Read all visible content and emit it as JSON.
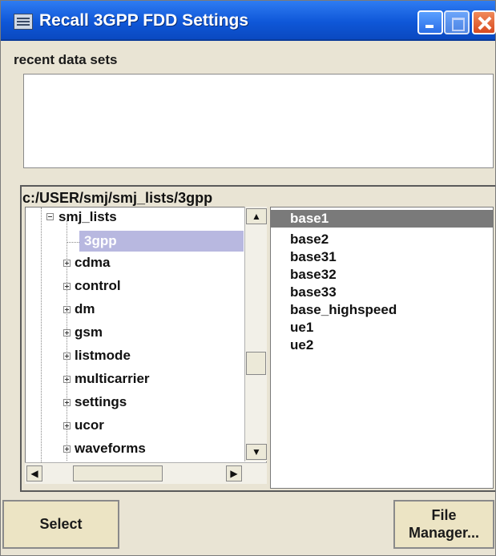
{
  "window": {
    "title": "Recall 3GPP FDD Settings",
    "accent_color": "#0f57d8",
    "titlebar_icons": [
      "app-icon",
      "minimize-icon",
      "maximize-icon",
      "close-icon"
    ]
  },
  "recent": {
    "label": "recent data sets",
    "items": []
  },
  "browser": {
    "path": "c:/USER/smj/smj_lists/3gpp",
    "tree": {
      "root": "smj_lists",
      "selected": "3gpp",
      "items": [
        "3gpp",
        "cdma",
        "control",
        "dm",
        "gsm",
        "listmode",
        "multicarrier",
        "settings",
        "ucor",
        "waveforms"
      ]
    },
    "files": {
      "selected": "base1",
      "items": [
        "base1",
        "base2",
        "base31",
        "base32",
        "base33",
        "base_highspeed",
        "ue1",
        "ue2"
      ]
    },
    "scroll_icons": [
      "up-arrow-icon",
      "down-arrow-icon",
      "left-arrow-icon",
      "right-arrow-icon"
    ],
    "selection_color": "#b8b8e0"
  },
  "buttons": {
    "select": "Select",
    "file_manager_line1": "File",
    "file_manager_line2": "Manager..."
  }
}
